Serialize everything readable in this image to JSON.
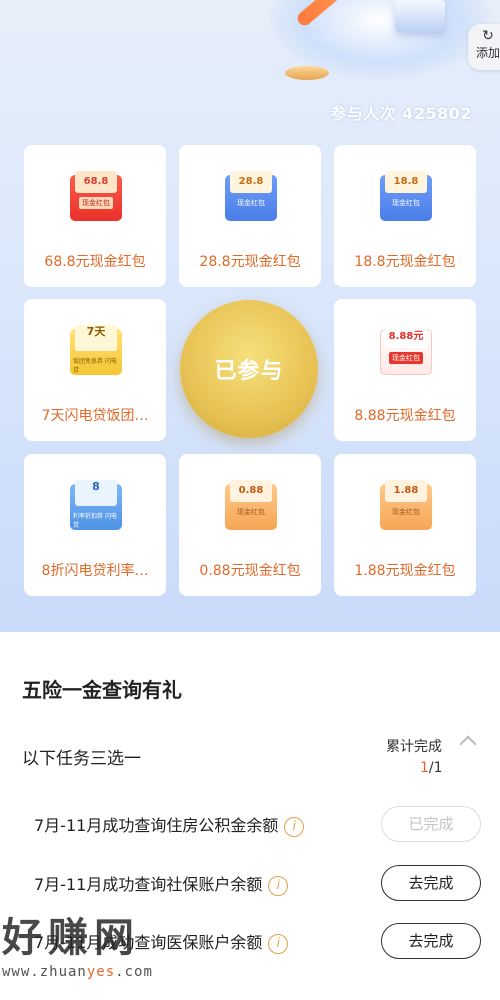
{
  "header": {
    "add_label": "添加",
    "add_icon": "refresh-icon",
    "participants_label": "参与人次",
    "participants_count": "425802"
  },
  "prizes": [
    {
      "label": "68.8元现金红包",
      "amount": "68.8",
      "sub": "现金红包",
      "style": "red"
    },
    {
      "label": "28.8元现金红包",
      "amount": "28.8",
      "sub": "现金红包",
      "style": "blue"
    },
    {
      "label": "18.8元现金红包",
      "amount": "18.8",
      "sub": "现金红包",
      "style": "blue"
    },
    {
      "label": "7天闪电贷饭团…",
      "amount": "7天",
      "sub": "饭团免息券 闪电贷",
      "style": "yellow"
    },
    {
      "label": "8.88元现金红包",
      "amount": "8.88元",
      "sub": "现金红包",
      "style": "redwhite"
    },
    {
      "label": "8折闪电贷利率…",
      "amount": "8",
      "sub": "利率折扣券 闪电贷",
      "style": "lightblue"
    },
    {
      "label": "0.88元现金红包",
      "amount": "0.88",
      "sub": "现金红包",
      "style": "orange"
    },
    {
      "label": "1.88元现金红包",
      "amount": "1.88",
      "sub": "现金红包",
      "style": "orange"
    }
  ],
  "center_button": "已参与",
  "sheet": {
    "title": "五险一金查询有礼",
    "task_hint": "以下任务三选一",
    "progress_label": "累计完成",
    "progress_done": "1",
    "progress_total": "/1",
    "tasks": [
      {
        "text": "7月-11月成功查询住房公积金余额",
        "button": "已完成",
        "state": "done"
      },
      {
        "text": "7月-11月成功查询社保账户余额",
        "button": "去完成",
        "state": "todo"
      },
      {
        "text": "7月-11月成功查询医保账户余额",
        "button": "去完成",
        "state": "todo"
      }
    ]
  },
  "watermark": {
    "text": "好赚网",
    "url_prefix": "www.zhuan",
    "url_accent": "yes",
    "url_suffix": ".com"
  }
}
